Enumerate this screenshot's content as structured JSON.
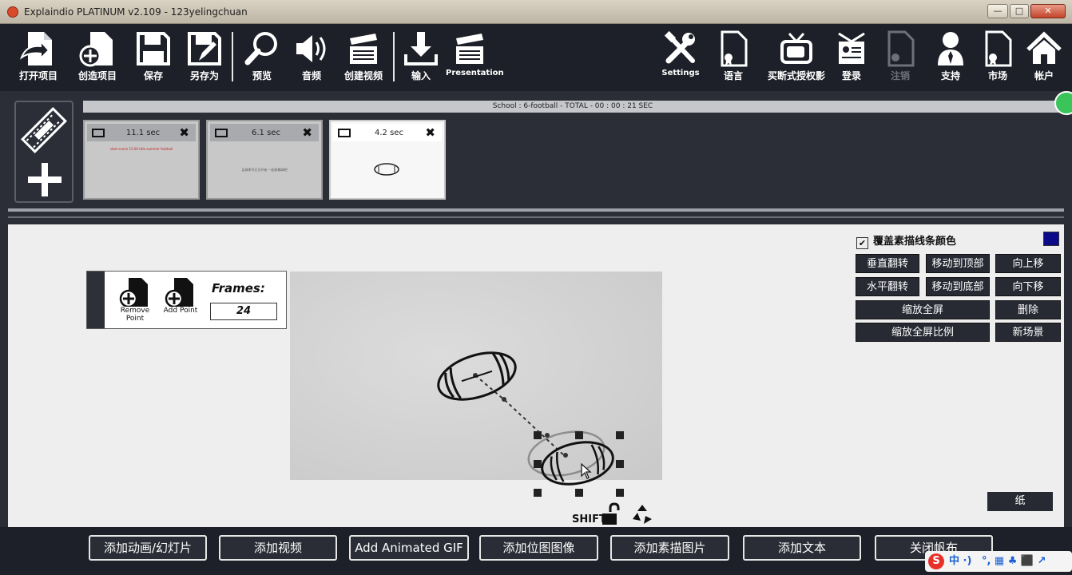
{
  "window": {
    "title": "Explaindio PLATINUM v2.109 - 123yelingchuan",
    "controls": {
      "minimize": "—",
      "maximize": "□",
      "close": "✕"
    }
  },
  "toolbar": {
    "left": [
      {
        "label": "打开项目",
        "icon": "open-project-icon"
      },
      {
        "label": "创造项目",
        "icon": "new-project-icon"
      },
      {
        "label": "保存",
        "icon": "save-icon"
      },
      {
        "label": "另存为",
        "icon": "save-as-icon"
      },
      {
        "label": "预览",
        "icon": "preview-search-icon"
      },
      {
        "label": "音频",
        "icon": "speaker-icon"
      },
      {
        "label": "创建视频",
        "icon": "clapperboard-icon"
      },
      {
        "label": "输入",
        "icon": "download-import-icon"
      },
      {
        "label": "Presentation",
        "icon": "presentation-clapperboard-icon"
      }
    ],
    "right": [
      {
        "label": "Settings",
        "icon": "tools-icon"
      },
      {
        "label": "语言",
        "icon": "language-document-icon"
      },
      {
        "label": "买断式授权影",
        "icon": "tv-icon"
      },
      {
        "label": "登录",
        "icon": "login-id-card-icon"
      },
      {
        "label": "注销",
        "icon": "logout-document-icon",
        "disabled": true
      },
      {
        "label": "支持",
        "icon": "support-person-icon"
      },
      {
        "label": "市场",
        "icon": "market-document-icon"
      },
      {
        "label": "帐户",
        "icon": "home-icon"
      }
    ]
  },
  "timeline": {
    "summary": "School : 6-football  -  TOTAL  -  00 : 00 : 21 SEC",
    "scenes": [
      {
        "duration": "11.1 sec",
        "thumb_text": "start scene 15:00 title summer football"
      },
      {
        "duration": "6.1 sec",
        "thumb_text": "足球季节正式开始 一起来踢球吧"
      },
      {
        "duration": "4.2 sec",
        "thumb_text": ""
      }
    ]
  },
  "frames_panel": {
    "remove_point": "Remove Point",
    "add_point": "Add Point",
    "frames_label": "Frames:",
    "frames_value": "24"
  },
  "options": {
    "overlay_sketch_color_label": "覆盖素描线条颜色",
    "overlay_checked": true,
    "sketch_color": "#0b0b8a",
    "buttons": {
      "flip_vertical": "垂直翻转",
      "move_to_top": "移动到顶部",
      "move_up": "向上移",
      "flip_horizontal": "水平翻转",
      "move_to_bottom": "移动到底部",
      "move_down": "向下移",
      "zoom_fullscreen": "缩放全屏",
      "delete": "删除",
      "zoom_fullscreen_ratio": "缩放全屏比例",
      "new_scene": "新场景"
    },
    "paper": "纸",
    "shift": "SHIFT"
  },
  "bottom_bar": [
    "添加动画/幻灯片",
    "添加视频",
    "Add Animated GIF",
    "添加位图图像",
    "添加素描图片",
    "添加文本",
    "关闭帆布"
  ],
  "ime": {
    "logo": "S",
    "mode": "中 ·)",
    "tray": "°, ▦ ♣ ⬛ ↗"
  },
  "colors": {
    "toolbar_bg": "#1d2028",
    "canvas_bg": "#eeeeee",
    "button_bg": "#272a33",
    "accent_green": "#3ac45a"
  }
}
